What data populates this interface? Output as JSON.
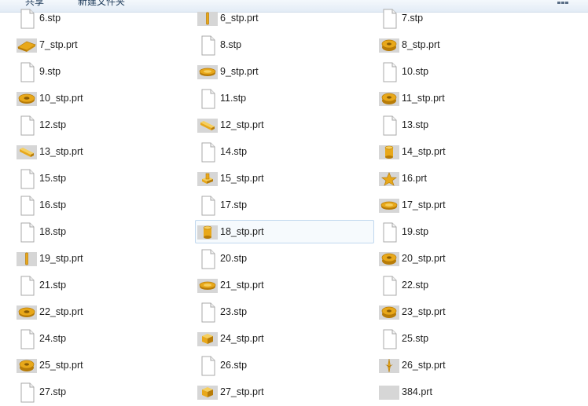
{
  "toolbar": {
    "share_label": "共享",
    "new_folder_label": "新建文件夹"
  },
  "files": [
    {
      "name": "6.stp",
      "type": "stp"
    },
    {
      "name": "6_stp.prt",
      "type": "prt",
      "icon": "pin-part-icon"
    },
    {
      "name": "7.stp",
      "type": "stp"
    },
    {
      "name": "7_stp.prt",
      "type": "prt",
      "icon": "plate-part-icon"
    },
    {
      "name": "8.stp",
      "type": "stp"
    },
    {
      "name": "8_stp.prt",
      "type": "prt",
      "icon": "ring-part-icon"
    },
    {
      "name": "9.stp",
      "type": "stp"
    },
    {
      "name": "9_stp.prt",
      "type": "prt",
      "icon": "disc-part-icon"
    },
    {
      "name": "10.stp",
      "type": "stp"
    },
    {
      "name": "10_stp.prt",
      "type": "prt",
      "icon": "washer-part-icon"
    },
    {
      "name": "11.stp",
      "type": "stp"
    },
    {
      "name": "11_stp.prt",
      "type": "prt",
      "icon": "ring-part-icon"
    },
    {
      "name": "12.stp",
      "type": "stp"
    },
    {
      "name": "12_stp.prt",
      "type": "prt",
      "icon": "bar-part-icon"
    },
    {
      "name": "13.stp",
      "type": "stp"
    },
    {
      "name": "13_stp.prt",
      "type": "prt",
      "icon": "bar-part-icon"
    },
    {
      "name": "14.stp",
      "type": "stp"
    },
    {
      "name": "14_stp.prt",
      "type": "prt",
      "icon": "cylinder-part-icon"
    },
    {
      "name": "15.stp",
      "type": "stp"
    },
    {
      "name": "15_stp.prt",
      "type": "prt",
      "icon": "bracket-part-icon"
    },
    {
      "name": "16.prt",
      "type": "prt",
      "icon": "star-part-icon"
    },
    {
      "name": "16.stp",
      "type": "stp"
    },
    {
      "name": "17.stp",
      "type": "stp"
    },
    {
      "name": "17_stp.prt",
      "type": "prt",
      "icon": "disc-part-icon"
    },
    {
      "name": "18.stp",
      "type": "stp"
    },
    {
      "name": "18_stp.prt",
      "type": "prt",
      "icon": "cylinder-part-icon",
      "selected": true
    },
    {
      "name": "19.stp",
      "type": "stp"
    },
    {
      "name": "19_stp.prt",
      "type": "prt",
      "icon": "pin-part-icon"
    },
    {
      "name": "20.stp",
      "type": "stp"
    },
    {
      "name": "20_stp.prt",
      "type": "prt",
      "icon": "ring-part-icon"
    },
    {
      "name": "21.stp",
      "type": "stp"
    },
    {
      "name": "21_stp.prt",
      "type": "prt",
      "icon": "disc-part-icon"
    },
    {
      "name": "22.stp",
      "type": "stp"
    },
    {
      "name": "22_stp.prt",
      "type": "prt",
      "icon": "washer-part-icon"
    },
    {
      "name": "23.stp",
      "type": "stp"
    },
    {
      "name": "23_stp.prt",
      "type": "prt",
      "icon": "ring-part-icon"
    },
    {
      "name": "24.stp",
      "type": "stp"
    },
    {
      "name": "24_stp.prt",
      "type": "prt",
      "icon": "block-part-icon"
    },
    {
      "name": "25.stp",
      "type": "stp"
    },
    {
      "name": "25_stp.prt",
      "type": "prt",
      "icon": "ring-part-icon"
    },
    {
      "name": "26.stp",
      "type": "stp"
    },
    {
      "name": "26_stp.prt",
      "type": "prt",
      "icon": "spike-part-icon"
    },
    {
      "name": "27.stp",
      "type": "stp"
    },
    {
      "name": "27_stp.prt",
      "type": "prt",
      "icon": "block-part-icon"
    },
    {
      "name": "384.prt",
      "type": "prt",
      "icon": "blank-part-icon"
    }
  ],
  "colors": {
    "part_gold": "#e8a81a",
    "part_shade": "#b87c08",
    "part_light": "#f6cf5e",
    "selection_border": "#c0d7ee"
  }
}
